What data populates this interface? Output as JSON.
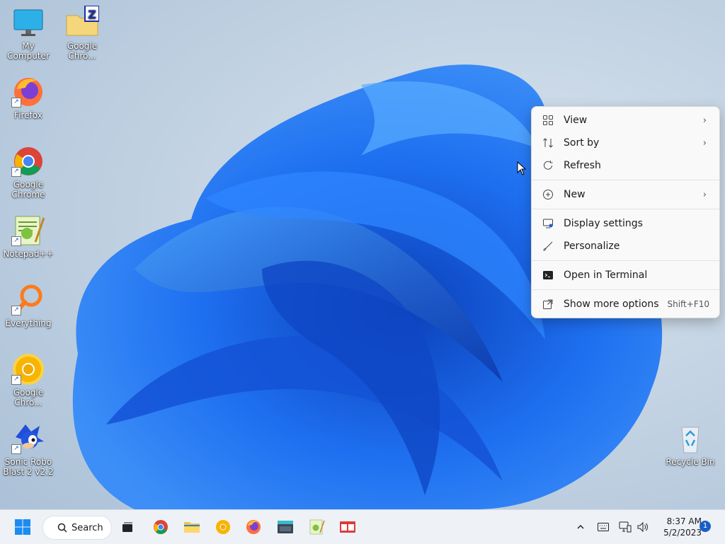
{
  "desktop": {
    "icons": [
      {
        "label": "My Computer"
      },
      {
        "label": "Google Chro..."
      },
      {
        "label": "Firefox"
      },
      {
        "label": "Google Chrome"
      },
      {
        "label": "Notepad++"
      },
      {
        "label": "Everything"
      },
      {
        "label": "Google Chro..."
      },
      {
        "label": "Sonic Robo Blast 2 v2.2"
      },
      {
        "label": "Recycle Bin"
      }
    ]
  },
  "context_menu": {
    "items": [
      {
        "label": "View",
        "icon": "grid-icon",
        "has_submenu": true
      },
      {
        "label": "Sort by",
        "icon": "sort-icon",
        "has_submenu": true
      },
      {
        "label": "Refresh",
        "icon": "refresh-icon"
      },
      {
        "label": "New",
        "icon": "plus-circle-icon",
        "has_submenu": true
      },
      {
        "label": "Display settings",
        "icon": "display-icon"
      },
      {
        "label": "Personalize",
        "icon": "brush-icon"
      },
      {
        "label": "Open in Terminal",
        "icon": "terminal-icon"
      },
      {
        "label": "Show more options",
        "icon": "external-icon",
        "shortcut": "Shift+F10"
      }
    ]
  },
  "taskbar": {
    "search_label": "Search",
    "clock_time": "8:37 AM",
    "clock_date": "5/2/2023",
    "notification_count": "1"
  },
  "colors": {
    "accent": "#1a5fc7",
    "bloom": "#1e6ff0",
    "menu_bg": "#f9f9f9",
    "taskbar_bg": "#eef1f6"
  }
}
